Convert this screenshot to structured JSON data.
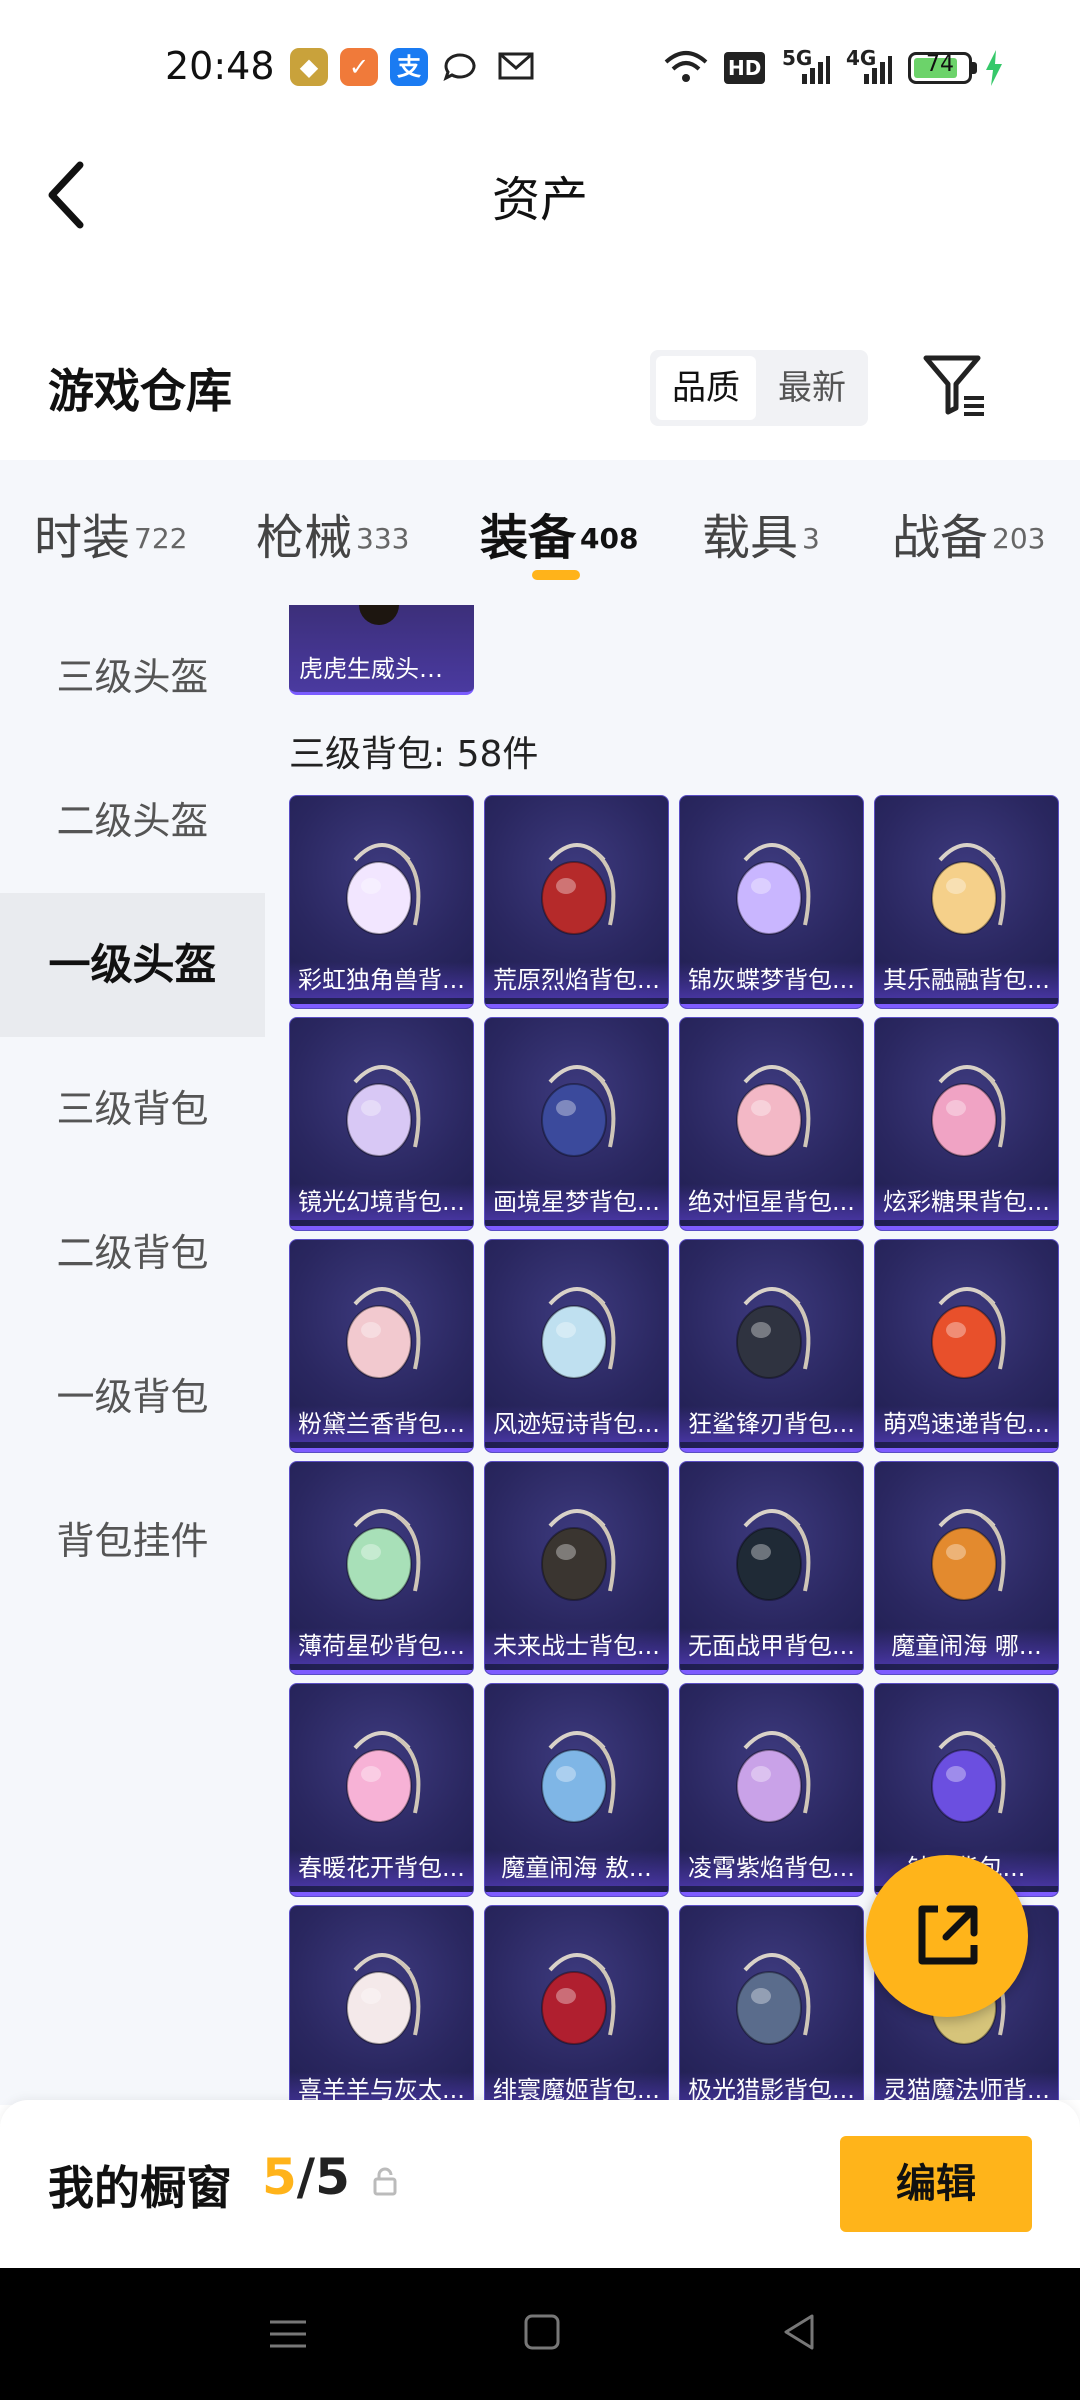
{
  "status_bar": {
    "time": "20:48",
    "network_badge": "HD",
    "net1": "5G",
    "net2": "4G",
    "battery": "74",
    "battery_fraction": 0.74,
    "notification_icons": [
      "game-app-icon",
      "app-icon",
      "alipay-icon",
      "chat-icon",
      "mail-icon"
    ]
  },
  "header": {
    "title": "资产"
  },
  "warehouse": {
    "title": "游戏仓库",
    "sort_options": [
      "品质",
      "最新"
    ],
    "active_sort": "品质"
  },
  "tabs": [
    {
      "label": "时装",
      "count": "722"
    },
    {
      "label": "枪械",
      "count": "333"
    },
    {
      "label": "装备",
      "count": "408",
      "active": true
    },
    {
      "label": "载具",
      "count": "3"
    },
    {
      "label": "战备",
      "count": "203"
    }
  ],
  "side_nav": [
    {
      "label": "三级头盔"
    },
    {
      "label": "二级头盔"
    },
    {
      "label": "一级头盔",
      "active": true
    },
    {
      "label": "三级背包"
    },
    {
      "label": "二级背包"
    },
    {
      "label": "一级背包"
    },
    {
      "label": "背包挂件"
    }
  ],
  "content": {
    "top_item": "虎虎生威头盔...",
    "section_title": "三级背包: 58件",
    "items": [
      {
        "name": "彩虹独角兽背...",
        "color": "#f2e6ff"
      },
      {
        "name": "荒原烈焰背包...",
        "color": "#b52a2a"
      },
      {
        "name": "锦灰蝶梦背包...",
        "color": "#c9b6ff"
      },
      {
        "name": "其乐融融背包...",
        "color": "#f5d08a"
      },
      {
        "name": "镜光幻境背包...",
        "color": "#d8c8f5"
      },
      {
        "name": "画境星梦背包...",
        "color": "#3b4a9c"
      },
      {
        "name": "绝对恒星背包...",
        "color": "#f3b8c6"
      },
      {
        "name": "炫彩糖果背包...",
        "color": "#f0a3c4"
      },
      {
        "name": "粉黛兰香背包...",
        "color": "#f2c9cf"
      },
      {
        "name": "风迹短诗背包...",
        "color": "#bfe0f0"
      },
      {
        "name": "狂鲨锋刃背包...",
        "color": "#2f3340"
      },
      {
        "name": "萌鸡速递背包...",
        "color": "#e8502b"
      },
      {
        "name": "薄荷星砂背包...",
        "color": "#a8e0b8"
      },
      {
        "name": "未来战士背包...",
        "color": "#3a3530"
      },
      {
        "name": "无面战甲背包...",
        "color": "#1f2a36"
      },
      {
        "name": "魔童闹海 哪...",
        "color": "#e38a2e"
      },
      {
        "name": "春暖花开背包...",
        "color": "#f7b2d6"
      },
      {
        "name": "魔童闹海 敖...",
        "color": "#7fb6e6"
      },
      {
        "name": "凌霄紫焰背包...",
        "color": "#c9a2e8"
      },
      {
        "name": "钛...背包...",
        "color": "#6b4fe0"
      },
      {
        "name": "喜羊羊与灰太...",
        "color": "#f4e9ea"
      },
      {
        "name": "绯寰魔姬背包...",
        "color": "#b01f2f"
      },
      {
        "name": "极光猎影背包...",
        "color": "#5a6c8c"
      },
      {
        "name": "灵猫魔法师背...",
        "color": "#d6c47a"
      }
    ]
  },
  "showcase": {
    "label": "我的橱窗",
    "current": "5",
    "separator": "/",
    "max": "5",
    "edit_label": "编辑"
  },
  "accent_color": "#ffb41a"
}
